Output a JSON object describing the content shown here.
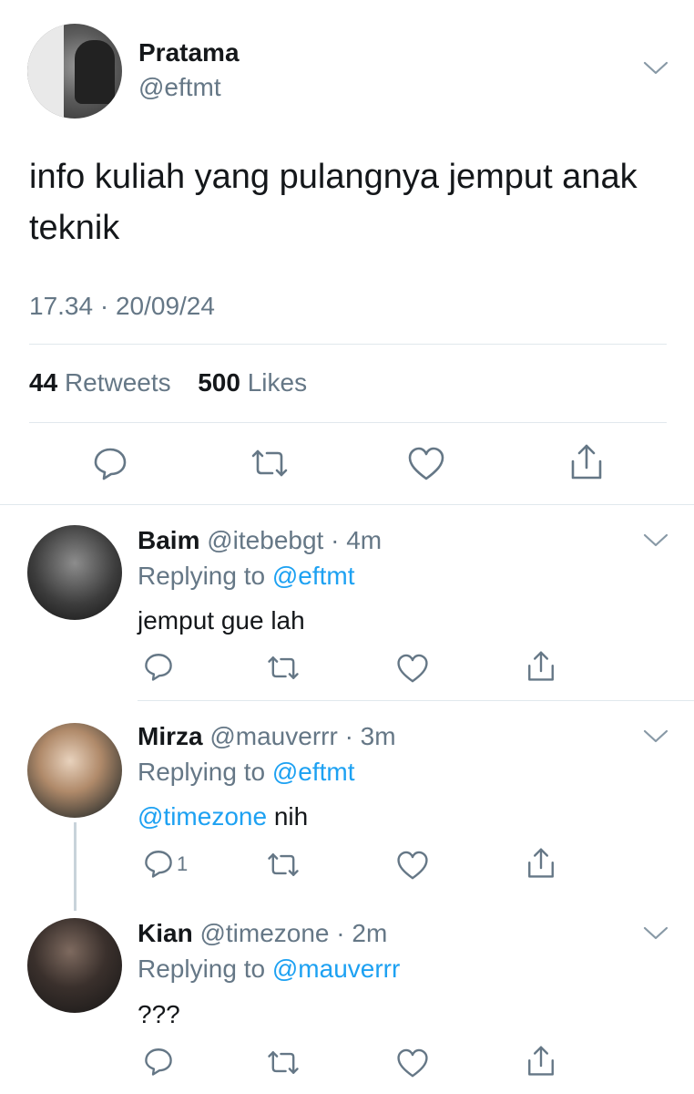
{
  "main_tweet": {
    "display_name": "Pratama",
    "handle": "@eftmt",
    "text": "info kuliah yang pulangnya jemput anak teknik",
    "timestamp": "17.34 · 20/09/24",
    "retweets_count": "44",
    "retweets_label": "Retweets",
    "likes_count": "500",
    "likes_label": "Likes",
    "actions": [
      "reply-icon",
      "retweet-icon",
      "like-icon",
      "share-icon"
    ]
  },
  "replies": [
    {
      "display_name": "Baim",
      "meta": "@itebebgt · 4m",
      "replying_label": "Replying to",
      "replying_to": "@eftmt",
      "mention": "",
      "text": "jemput gue lah",
      "reply_count": ""
    },
    {
      "display_name": "Mirza",
      "meta": "@mauverrr · 3m",
      "replying_label": "Replying to",
      "replying_to": "@eftmt",
      "mention": "@timezone",
      "text": " nih",
      "reply_count": "1"
    },
    {
      "display_name": "Kian",
      "meta": "@timezone · 2m",
      "replying_label": "Replying to",
      "replying_to": "@mauverrr",
      "mention": "",
      "text": "???",
      "reply_count": ""
    }
  ],
  "colors": {
    "accent": "#1da1f2",
    "secondary_text": "#657786",
    "primary_text": "#14171a",
    "divider": "#e1e8ed",
    "icon": "#657786"
  }
}
